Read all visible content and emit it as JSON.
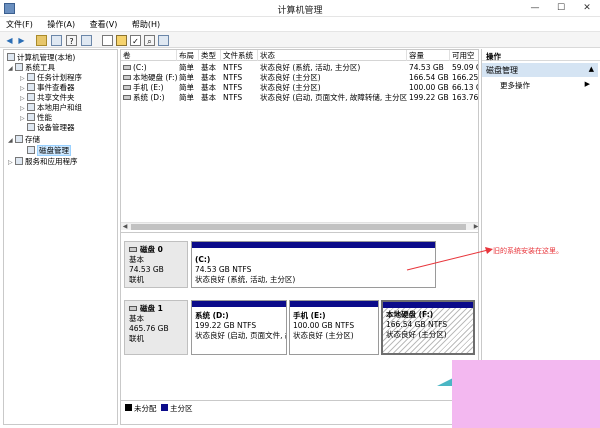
{
  "window": {
    "title": "计算机管理",
    "controls": [
      "—",
      "☐",
      "✕"
    ]
  },
  "menu": [
    "文件(F)",
    "操作(A)",
    "查看(V)",
    "帮助(H)"
  ],
  "tree": {
    "root": "计算机管理(本地)",
    "system_tools": "系统工具",
    "task_scheduler": "任务计划程序",
    "event_viewer": "事件查看器",
    "shared_folders": "共享文件夹",
    "local_users": "本地用户和组",
    "performance": "性能",
    "device_manager": "设备管理器",
    "storage": "存储",
    "disk_management": "磁盘管理",
    "services_apps": "服务和应用程序"
  },
  "volume_table": {
    "columns": [
      "卷",
      "布局",
      "类型",
      "文件系统",
      "状态",
      "容量",
      "可用空"
    ],
    "rows": [
      [
        "(C:)",
        "简单",
        "基本",
        "NTFS",
        "状态良好 (系统, 活动, 主分区)",
        "74.53 GB",
        "59.09 G"
      ],
      [
        "本地硬盘 (F:)",
        "简单",
        "基本",
        "NTFS",
        "状态良好 (主分区)",
        "166.54 GB",
        "166.25"
      ],
      [
        "手机 (E:)",
        "简单",
        "基本",
        "NTFS",
        "状态良好 (主分区)",
        "100.00 GB",
        "66.13 G"
      ],
      [
        "系统 (D:)",
        "简单",
        "基本",
        "NTFS",
        "状态良好 (启动, 页面文件, 故障转储, 主分区)",
        "199.22 GB",
        "163.76"
      ]
    ]
  },
  "disks": {
    "disk0": {
      "name": "磁盘 0",
      "type": "基本",
      "size": "74.53 GB",
      "status": "联机",
      "partitions": [
        {
          "name": "(C:)",
          "size": "74.53 GB NTFS",
          "status": "状态良好 (系统, 活动, 主分区)"
        }
      ]
    },
    "disk1": {
      "name": "磁盘 1",
      "type": "基本",
      "size": "465.76 GB",
      "status": "联机",
      "partitions": [
        {
          "name": "系统  (D:)",
          "size": "199.22 GB NTFS",
          "status": "状态良好 (启动, 页面文件, 故"
        },
        {
          "name": "手机  (E:)",
          "size": "100.00 GB NTFS",
          "status": "状态良好 (主分区)"
        },
        {
          "name": "本地硬盘  (F:)",
          "size": "166.54 GB NTFS",
          "status": "状态良好 (主分区)"
        }
      ]
    }
  },
  "legend": {
    "unallocated": "未分配",
    "primary": "主分区",
    "unallocated_color": "#000000",
    "primary_color": "#0b0b8a"
  },
  "actions": {
    "header": "操作",
    "group": "磁盘管理",
    "more": "更多操作"
  },
  "annotation": "旧的系统安装在这里。",
  "colors": {
    "accent_red": "#e8353b",
    "selection": "#cde8ff",
    "action_group": "#d5e4f3",
    "pink_overlay": "#f3b8f0"
  }
}
